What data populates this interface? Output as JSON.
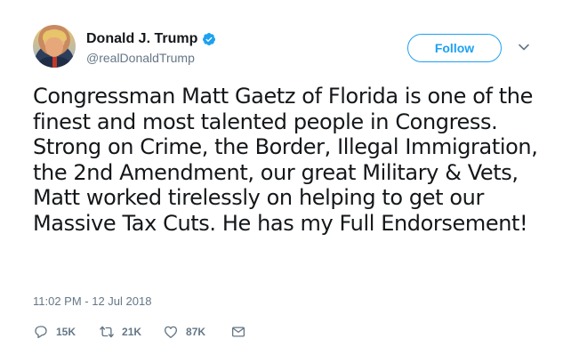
{
  "user": {
    "display_name": "Donald J. Trump",
    "handle": "@realDonaldTrump",
    "verified": true
  },
  "follow_button": {
    "label": "Follow"
  },
  "tweet": {
    "text": "Congressman Matt Gaetz of Florida is one of the finest and most talented people in Congress. Strong on Crime, the Border, Illegal Immigration, the 2nd Amendment, our great Military & Vets, Matt worked tirelessly on helping to get our Massive Tax Cuts. He has my Full Endorsement!",
    "timestamp": "11:02 PM - 12 Jul 2018"
  },
  "actions": {
    "replies": "15K",
    "retweets": "21K",
    "likes": "87K"
  },
  "colors": {
    "accent": "#1da1f2",
    "muted": "#657786",
    "text": "#14171a"
  }
}
